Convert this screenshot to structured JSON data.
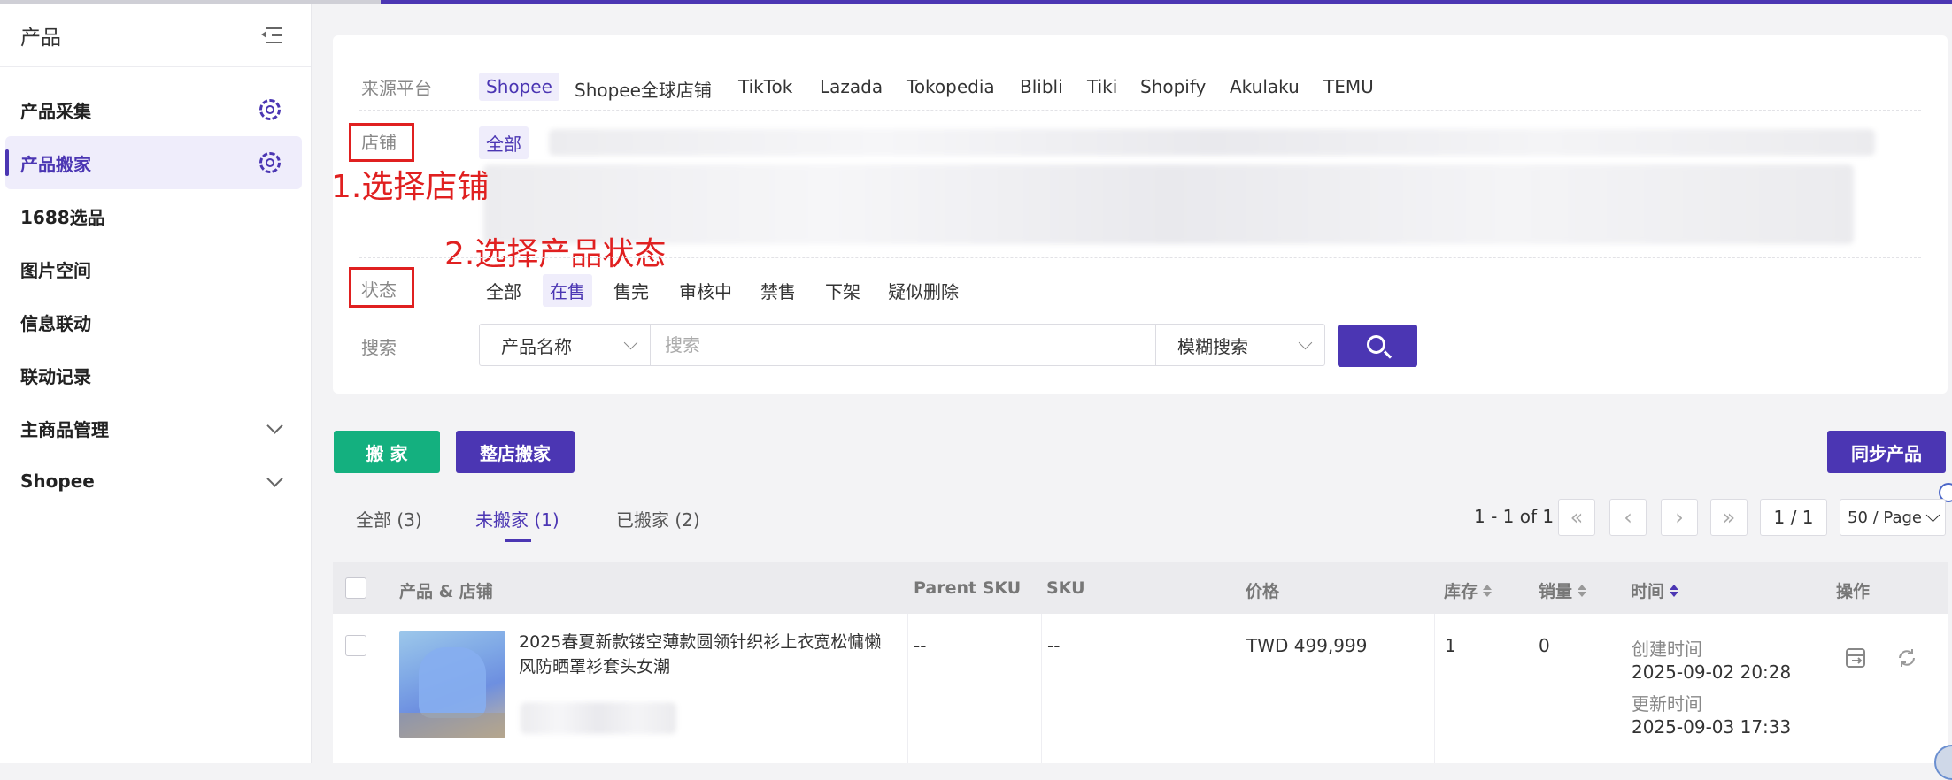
{
  "sidebar": {
    "title": "产品",
    "items": [
      {
        "label": "产品采集"
      },
      {
        "label": "产品搬家"
      },
      {
        "label": "1688选品"
      },
      {
        "label": "图片空间"
      },
      {
        "label": "信息联动"
      },
      {
        "label": "联动记录"
      },
      {
        "label": "主商品管理"
      },
      {
        "label": "Shopee"
      }
    ]
  },
  "filters": {
    "platform_label": "来源平台",
    "platforms": [
      "Shopee",
      "Shopee全球店铺",
      "TikTok",
      "Lazada",
      "Tokopedia",
      "Blibli",
      "Tiki",
      "Shopify",
      "Akulaku",
      "TEMU"
    ],
    "shop_label": "店铺",
    "shop_all": "全部",
    "status_label": "状态",
    "statuses": [
      "全部",
      "在售",
      "售完",
      "审核中",
      "禁售",
      "下架",
      "疑似删除"
    ],
    "search_label": "搜索",
    "search_field": "产品名称",
    "search_placeholder": "搜索",
    "search_mode": "模糊搜索"
  },
  "annotations": {
    "step1": "1.选择店铺",
    "step2": "2.选择产品状态"
  },
  "actions": {
    "move": "搬 家",
    "move_shop": "整店搬家",
    "sync": "同步产品"
  },
  "tabs": [
    "全部 (3)",
    "未搬家 (1)",
    "已搬家 (2)"
  ],
  "pagination": {
    "range": "1 - 1 of 1",
    "page": "1 / 1",
    "page_size": "50 / Page"
  },
  "table": {
    "headers": [
      "产品 & 店铺",
      "Parent SKU",
      "SKU",
      "价格",
      "库存",
      "销量",
      "时间",
      "操作"
    ],
    "rows": [
      {
        "name": "2025春夏新款镂空薄款圆领针织衫上衣宽松慵懒风防晒罩衫套头女潮",
        "parent_sku": "--",
        "sku": "--",
        "price": "TWD 499,999",
        "stock": "1",
        "sales": "0",
        "created_label": "创建时间",
        "created": "2025-09-02 20:28",
        "updated_label": "更新时间",
        "updated": "2025-09-03 17:33"
      }
    ]
  },
  "colors": {
    "accent": "#4b36b3",
    "green": "#14b07f",
    "annotation": "#e02020"
  }
}
